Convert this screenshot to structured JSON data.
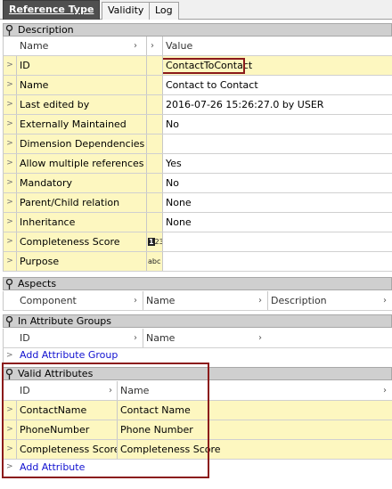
{
  "tabs": [
    "Reference Type",
    "Validity",
    "Log"
  ],
  "description": {
    "title": "Description",
    "headers": [
      "Name",
      "Value"
    ],
    "rows": [
      {
        "name": "ID",
        "value": "ContactToContact"
      },
      {
        "name": "Name",
        "value": "Contact to Contact"
      },
      {
        "name": "Last edited by",
        "value": "2016-07-26 15:26:27.0 by USER"
      },
      {
        "name": "Externally Maintained",
        "value": "No"
      },
      {
        "name": "Dimension Dependencies",
        "value": ""
      },
      {
        "name": "Allow multiple references",
        "value": "Yes"
      },
      {
        "name": "Mandatory",
        "value": "No"
      },
      {
        "name": "Parent/Child relation",
        "value": "None"
      },
      {
        "name": "Inheritance",
        "value": "None"
      },
      {
        "name": "Completeness Score",
        "value": ""
      },
      {
        "name": "Purpose",
        "value": ""
      }
    ]
  },
  "aspects": {
    "title": "Aspects",
    "headers": [
      "Component",
      "Name",
      "Description"
    ]
  },
  "attribute_groups": {
    "title": "In Attribute Groups",
    "headers": [
      "ID",
      "Name"
    ],
    "add_label": "Add Attribute Group"
  },
  "valid_attributes": {
    "title": "Valid Attributes",
    "headers": [
      "ID",
      "Name"
    ],
    "rows": [
      {
        "id": "ContactName",
        "name": "Contact Name"
      },
      {
        "id": "PhoneNumber",
        "name": "Phone Number"
      },
      {
        "id": "Completeness Score",
        "name": "Completeness Score"
      }
    ],
    "add_label": "Add Attribute"
  },
  "icons": {
    "pin": "pushpin-icon",
    "row_arrow": "chevron-right-icon",
    "numeric_type": "numeric-type-icon",
    "text_type": "text-type-icon"
  },
  "colors": {
    "active_tab": "#4f4f4f",
    "row_highlight": "#fdf7c0",
    "section_header": "#cfcfcf",
    "selection_box": "#8b1a1a",
    "link": "#1010d0"
  }
}
